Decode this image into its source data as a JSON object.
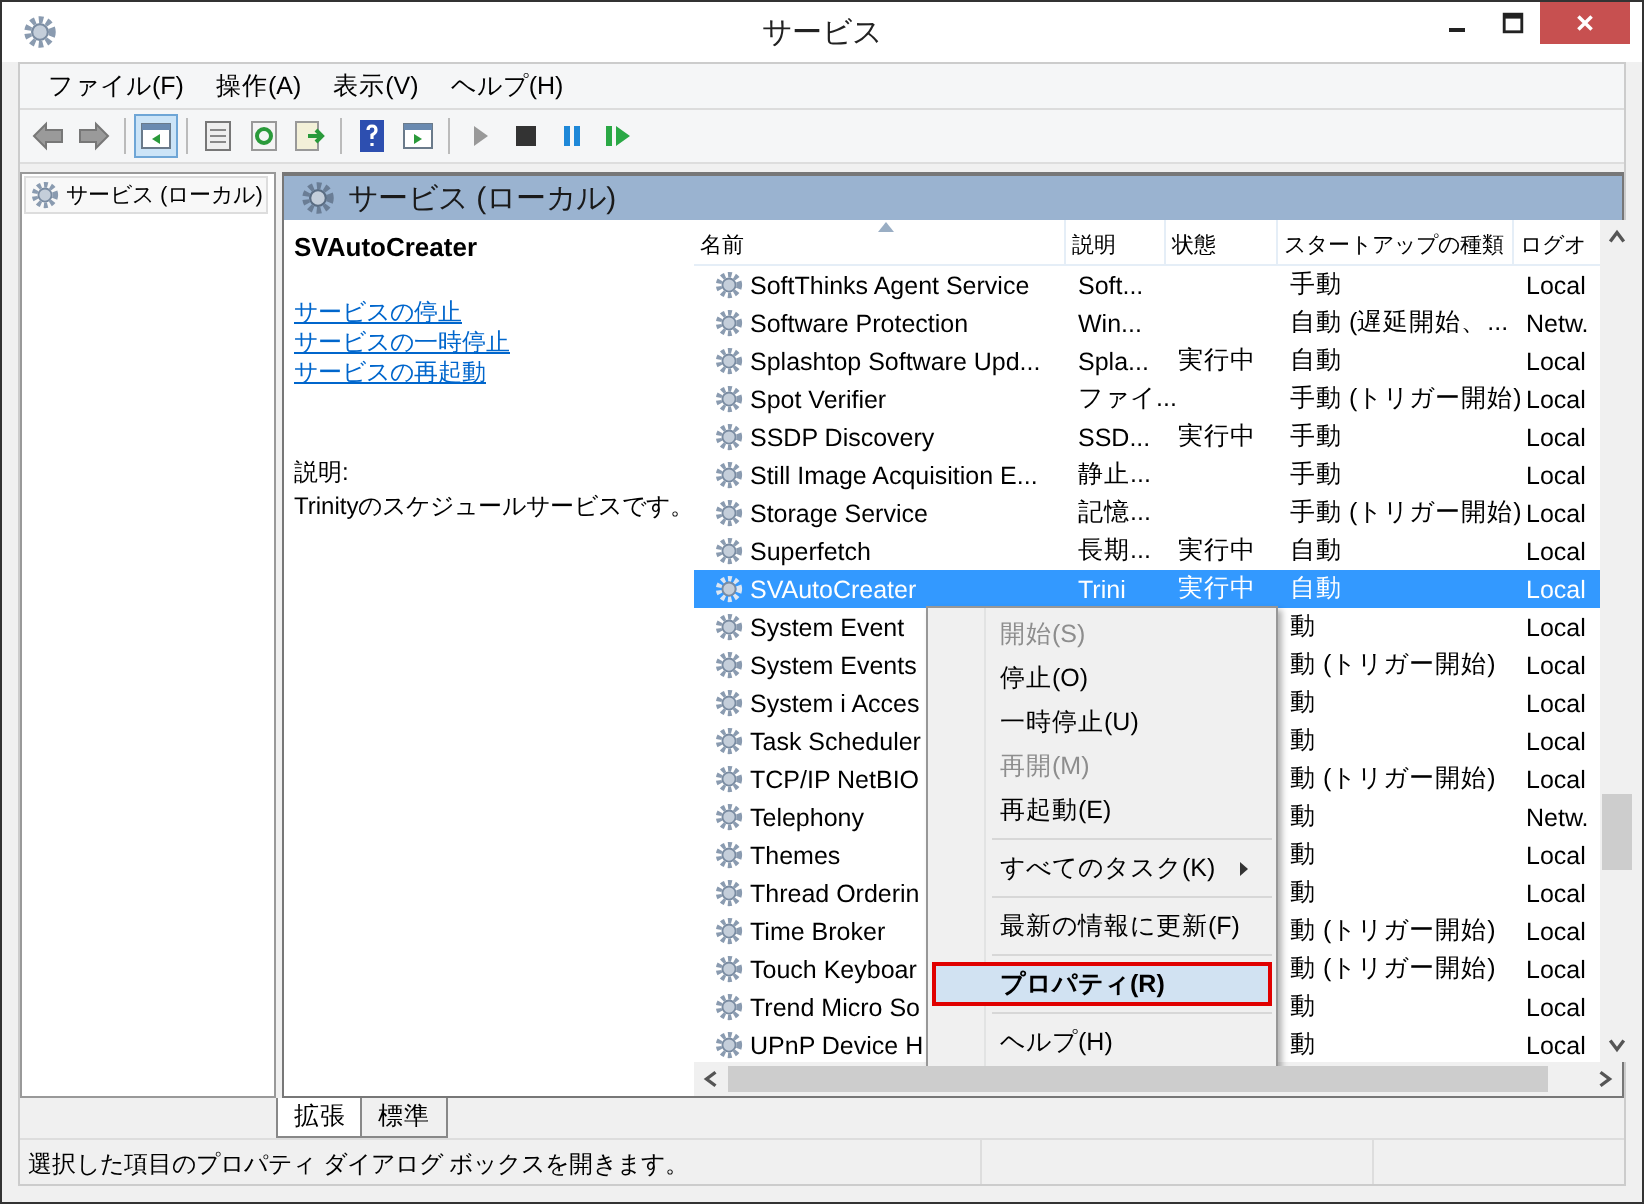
{
  "window": {
    "title": "サービス"
  },
  "menu_bar": [
    "ファイル(F)",
    "操作(A)",
    "表示(V)",
    "ヘルプ(H)"
  ],
  "toolbar": [
    {
      "kind": "back",
      "pressed": false
    },
    {
      "kind": "forward",
      "pressed": false
    },
    {
      "kind": "sep"
    },
    {
      "kind": "tree",
      "pressed": true
    },
    {
      "kind": "sep"
    },
    {
      "kind": "props",
      "pressed": false
    },
    {
      "kind": "refresh",
      "pressed": false
    },
    {
      "kind": "export",
      "pressed": false
    },
    {
      "kind": "sep"
    },
    {
      "kind": "help",
      "pressed": false
    },
    {
      "kind": "pane",
      "pressed": false
    },
    {
      "kind": "sep"
    },
    {
      "kind": "play",
      "pressed": false
    },
    {
      "kind": "stop",
      "pressed": false
    },
    {
      "kind": "pause",
      "pressed": false
    },
    {
      "kind": "resume",
      "pressed": false
    }
  ],
  "tree": {
    "label": "サービス (ローカル)",
    "selected": false
  },
  "panel_title": "サービス (ローカル)",
  "detail": {
    "title": "SVAutoCreater",
    "links": [
      "サービスの停止",
      "サービスの一時停止",
      "サービスの再起動"
    ],
    "description_label": "説明:",
    "description": "Trinityのスケジュールサービスです。"
  },
  "table": {
    "columns": [
      "名前",
      "説明",
      "状態",
      "スタートアップの種類",
      "ログオ"
    ],
    "rows": [
      {
        "name": "SoftThinks Agent Service",
        "description": "Soft...",
        "startup": "手動",
        "logon": "Local",
        "selected": false
      },
      {
        "name": "Software Protection",
        "description": "Win...",
        "startup": "自動 (遅延開始、...",
        "logon": "Netw.",
        "selected": false
      },
      {
        "name": "Splashtop Software Upd...",
        "description": "Spla...",
        "status": "実行中",
        "startup": "自動",
        "logon": "Local",
        "selected": false
      },
      {
        "name": "Spot Verifier",
        "description": "ファイ...",
        "startup": "手動 (トリガー開始)",
        "logon": "Local",
        "selected": false
      },
      {
        "name": "SSDP Discovery",
        "description": "SSD...",
        "status": "実行中",
        "startup": "手動",
        "logon": "Local",
        "selected": false
      },
      {
        "name": "Still Image Acquisition E...",
        "description": "静止...",
        "startup": "手動",
        "logon": "Local",
        "selected": false
      },
      {
        "name": "Storage Service",
        "description": "記憶...",
        "startup": "手動 (トリガー開始)",
        "logon": "Local",
        "selected": false
      },
      {
        "name": "Superfetch",
        "description": "長期...",
        "status": "実行中",
        "startup": "自動",
        "logon": "Local",
        "selected": false
      },
      {
        "name": "SVAutoCreater",
        "description": "Trini",
        "status": "実行中",
        "startup": "自動",
        "logon": "Local",
        "selected": true
      },
      {
        "name": "System Event",
        "startup": "動",
        "logon": "Local",
        "selected": false
      },
      {
        "name": "System Events",
        "startup": "動 (トリガー開始)",
        "logon": "Local",
        "selected": false
      },
      {
        "name": "System i Acces",
        "startup": "動",
        "logon": "Local",
        "selected": false
      },
      {
        "name": "Task Scheduler",
        "startup": "動",
        "logon": "Local",
        "selected": false
      },
      {
        "name": "TCP/IP NetBIO",
        "startup": "動 (トリガー開始)",
        "logon": "Local",
        "selected": false
      },
      {
        "name": "Telephony",
        "startup": "動",
        "logon": "Netw.",
        "selected": false
      },
      {
        "name": "Themes",
        "startup": "動",
        "logon": "Local",
        "selected": false
      },
      {
        "name": "Thread Orderin",
        "startup": "動",
        "logon": "Local",
        "selected": false
      },
      {
        "name": "Time Broker",
        "startup": "動 (トリガー開始)",
        "logon": "Local",
        "selected": false
      },
      {
        "name": "Touch Keyboar",
        "startup": "動 (トリガー開始)",
        "logon": "Local",
        "selected": false
      },
      {
        "name": "Trend Micro So",
        "startup": "動",
        "logon": "Local",
        "selected": false
      },
      {
        "name": "UPnP Device H",
        "startup": "動",
        "logon": "Local",
        "selected": false
      }
    ]
  },
  "context_menu": [
    {
      "kind": "item",
      "label": "開始(S)",
      "disabled": true,
      "highlighted": false
    },
    {
      "kind": "item",
      "label": "停止(O)",
      "disabled": false,
      "highlighted": false
    },
    {
      "kind": "item",
      "label": "一時停止(U)",
      "disabled": false,
      "highlighted": false
    },
    {
      "kind": "item",
      "label": "再開(M)",
      "disabled": true,
      "highlighted": false
    },
    {
      "kind": "item",
      "label": "再起動(E)",
      "disabled": false,
      "highlighted": false
    },
    {
      "kind": "sep"
    },
    {
      "kind": "submenu",
      "label": "すべてのタスク(K)",
      "disabled": false,
      "highlighted": false
    },
    {
      "kind": "sep"
    },
    {
      "kind": "item",
      "label": "最新の情報に更新(F)",
      "disabled": false,
      "highlighted": false
    },
    {
      "kind": "sep"
    },
    {
      "kind": "item",
      "label": "プロパティ(R)",
      "disabled": false,
      "highlighted": true
    },
    {
      "kind": "sep"
    },
    {
      "kind": "item",
      "label": "ヘルプ(H)",
      "disabled": false,
      "highlighted": false
    }
  ],
  "bottom_tabs": [
    {
      "label": "拡張",
      "selected": true
    },
    {
      "label": "標準",
      "selected": false
    }
  ],
  "status_bar": "選択した項目のプロパティ ダイアログ ボックスを開きます。"
}
